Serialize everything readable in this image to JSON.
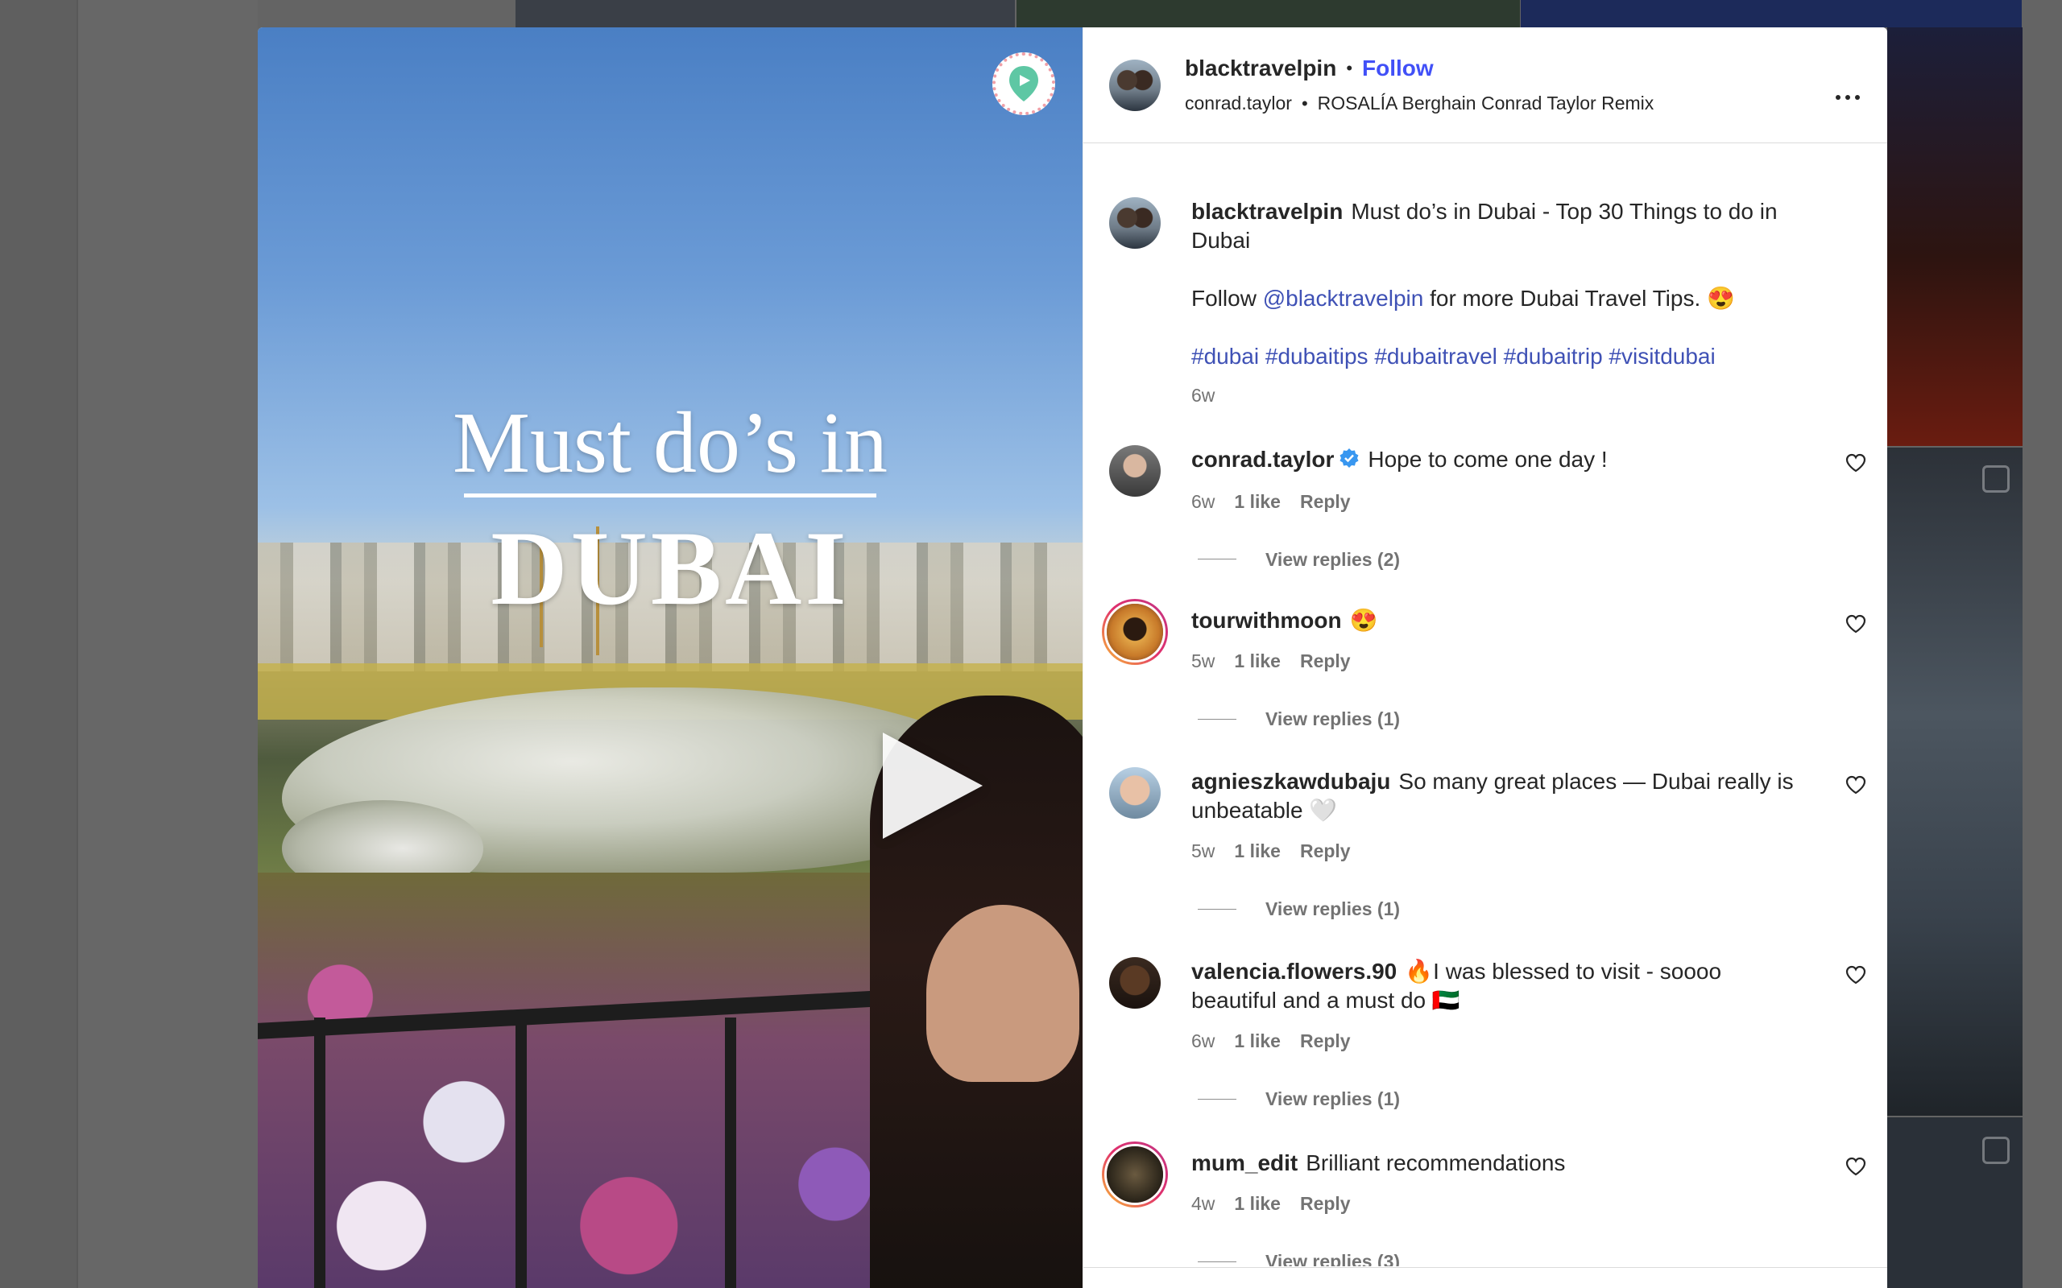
{
  "post": {
    "author": "blacktravelpin",
    "follow_label": "Follow",
    "audio_user": "conrad.taylor",
    "audio_track": "ROSALÍA Berghain Conrad Taylor Remix",
    "overlay_line1": "Must do’s in",
    "overlay_line2": "DUBAI"
  },
  "caption": {
    "user": "blacktravelpin",
    "title": "Must do’s in Dubai - Top 30 Things to do in Dubai",
    "follow_prefix": "Follow",
    "mention": "@blacktravelpin",
    "follow_suffix": "for more Dubai Travel Tips. 😍",
    "hashtags": [
      "#dubai",
      "#dubaitips",
      "#dubaitravel",
      "#dubaitrip",
      "#visitdubai"
    ],
    "time": "6w"
  },
  "comments": [
    {
      "user": "conrad.taylor",
      "text": "Hope to come one day !",
      "time": "6w",
      "likes": "1 like",
      "reply": "Reply",
      "replies": "View replies (2)"
    },
    {
      "user": "tourwithmoon",
      "text": "😍",
      "time": "5w",
      "likes": "1 like",
      "reply": "Reply",
      "replies": "View replies (1)"
    },
    {
      "user": "agnieszkawdubaju",
      "text": "So many great places — Dubai really is unbeatable 🤍",
      "time": "5w",
      "likes": "1 like",
      "reply": "Reply",
      "replies": "View replies (1)"
    },
    {
      "user": "valencia.flowers.90",
      "text": "🔥I was blessed to visit - soooo beautiful and a must do 🇦🇪",
      "time": "6w",
      "likes": "1 like",
      "reply": "Reply",
      "replies": "View replies (1)"
    },
    {
      "user": "mum_edit",
      "text": "Brilliant recommendations",
      "time": "4w",
      "likes": "1 like",
      "reply": "Reply",
      "replies": "View replies (3)"
    }
  ],
  "colors": {
    "link": "#4150f7",
    "hashtag": "#3f51b5",
    "muted": "#737373"
  },
  "icons": [
    "location-pin-icon",
    "play-icon",
    "more-options-icon",
    "verified-badge-icon",
    "heart-icon",
    "comment-icon",
    "share-icon",
    "save-icon"
  ]
}
